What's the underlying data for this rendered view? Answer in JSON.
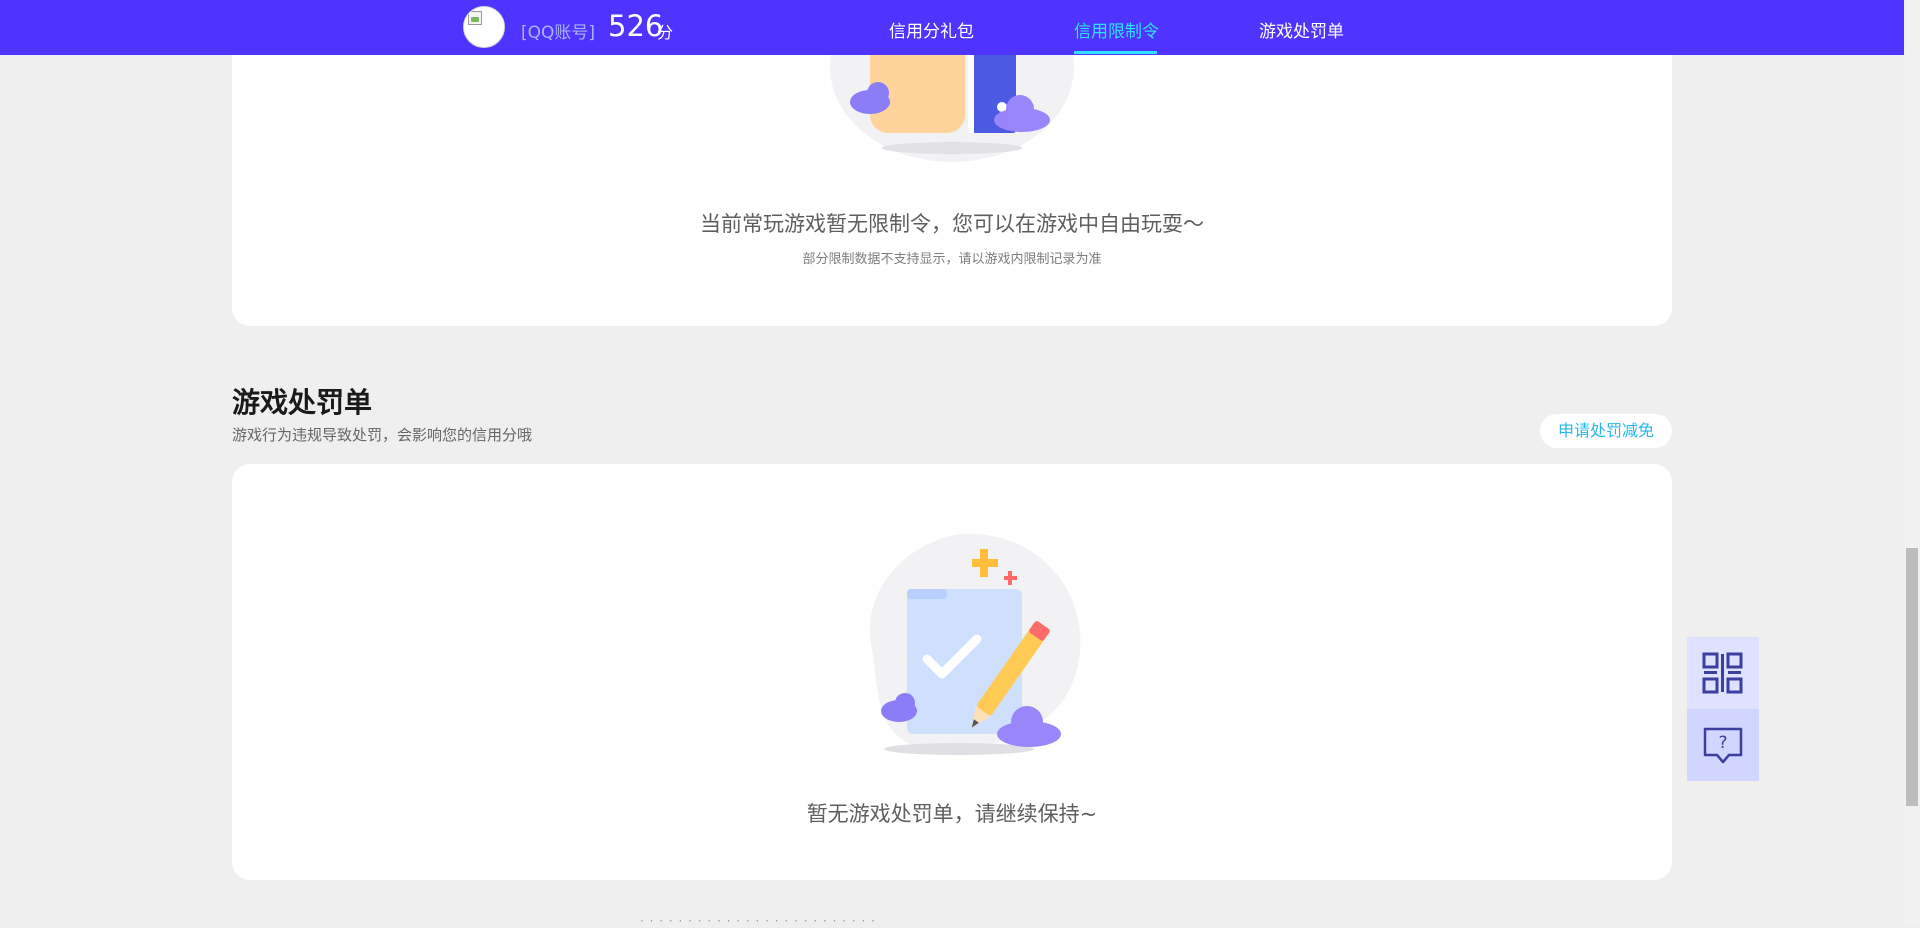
{
  "header": {
    "account_label": "[QQ账号]",
    "score_value": "526",
    "score_unit": "分",
    "tabs": [
      {
        "label": "信用分礼包",
        "active": false
      },
      {
        "label": "信用限制令",
        "active": true
      },
      {
        "label": "游戏处罚单",
        "active": false
      }
    ],
    "bg_color": "#4f33ff",
    "active_color": "#2fe0ff"
  },
  "restriction_section": {
    "empty_title": "当前常玩游戏暂无限制令，您可以在游戏中自由玩耍～",
    "empty_note": "部分限制数据不支持显示，请以游戏内限制记录为准"
  },
  "penalty_section": {
    "title": "游戏处罚单",
    "description": "游戏行为违规导致处罚，会影响您的信用分哦",
    "appeal_button": "申请处罚减免",
    "empty_title": "暂无游戏处罚单，请继续保持~"
  },
  "side_tools": [
    {
      "icon": "qr-code-icon"
    },
    {
      "icon": "help-question-icon"
    }
  ]
}
